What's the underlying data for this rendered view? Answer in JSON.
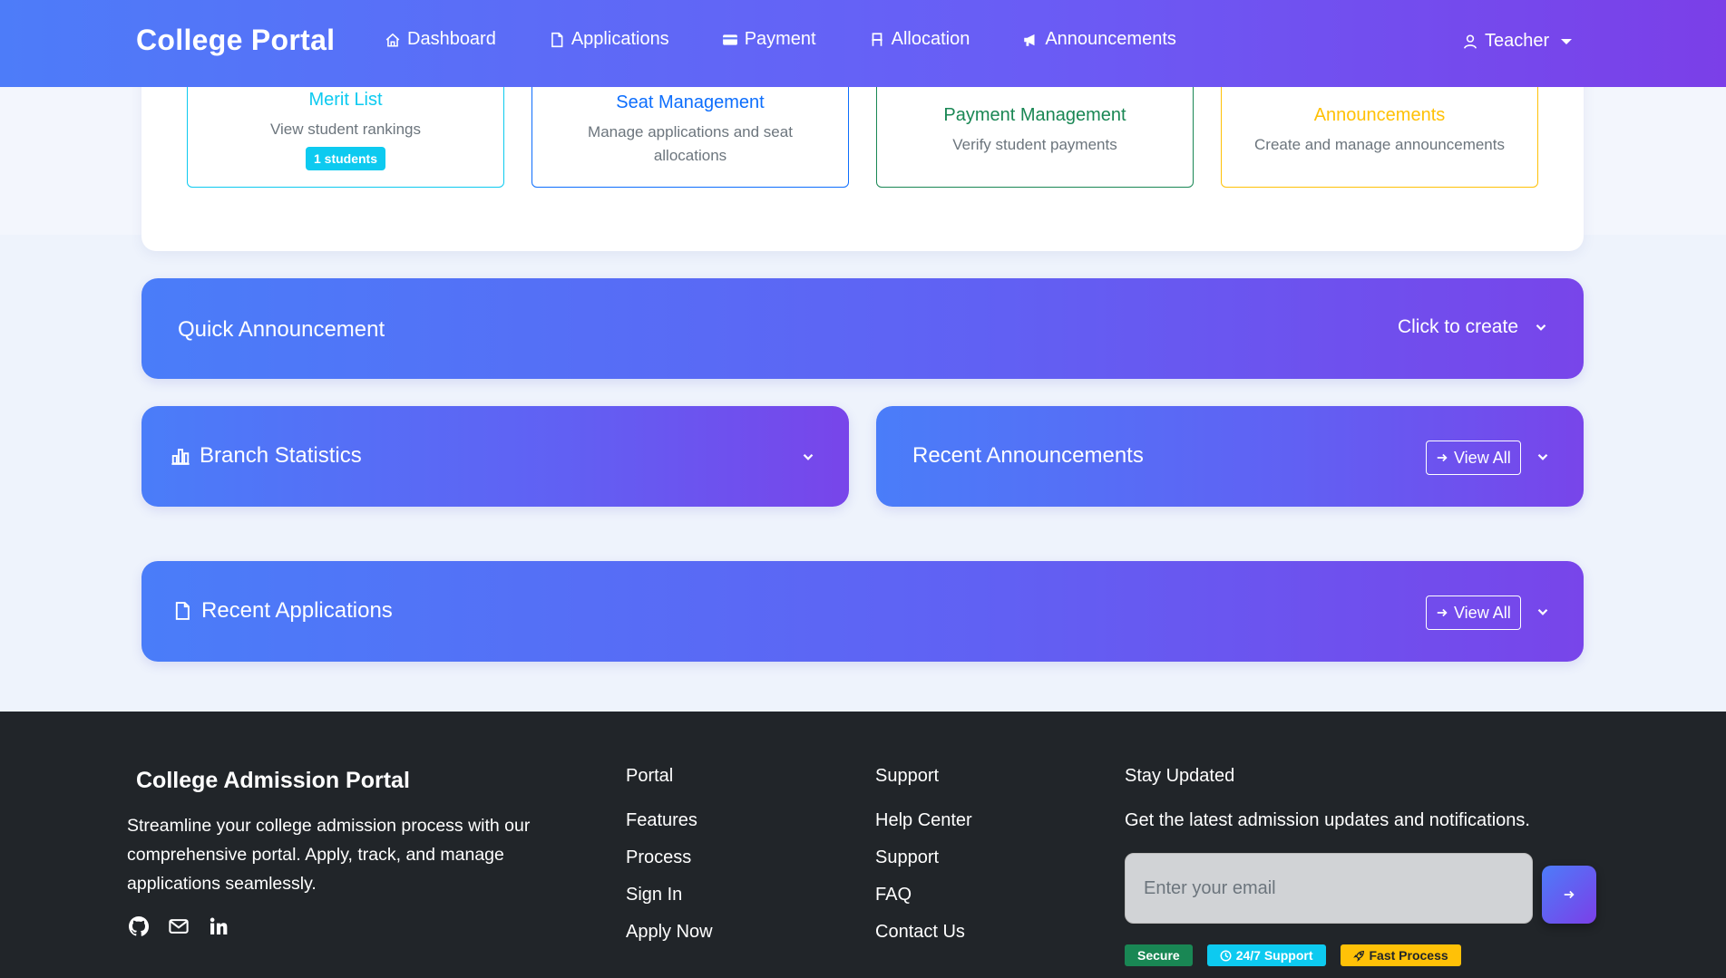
{
  "navbar": {
    "brand": "College Portal",
    "links": [
      {
        "label": "Dashboard",
        "icon": "house-icon"
      },
      {
        "label": "Applications",
        "icon": "file-icon"
      },
      {
        "label": "Payment",
        "icon": "credit-card-icon"
      },
      {
        "label": "Allocation",
        "icon": "chair-icon"
      },
      {
        "label": "Announcements",
        "icon": "megaphone-icon"
      }
    ],
    "user": {
      "label": "Teacher",
      "icon": "person-icon"
    }
  },
  "feature_cards": [
    {
      "title": "Merit List",
      "description": "View student rankings",
      "badge": "1 students",
      "color": "#0dcaf0"
    },
    {
      "title": "Seat Management",
      "description": "Manage applications and seat allocations",
      "color": "#0d6efd"
    },
    {
      "title": "Payment Management",
      "description": "Verify student payments",
      "color": "#198754"
    },
    {
      "title": "Announcements",
      "description": "Create and manage announcements",
      "color": "#ffc107"
    }
  ],
  "quick_announcement": {
    "title": "Quick Announcement",
    "action": "Click to create"
  },
  "branch_statistics": {
    "title": "Branch Statistics",
    "icon": "bar-chart-icon"
  },
  "recent_announcements": {
    "title": "Recent Announcements",
    "view_all": "View All"
  },
  "recent_applications": {
    "title": "Recent Applications",
    "view_all": "View All",
    "icon": "file-icon"
  },
  "footer": {
    "brand": "College Admission Portal",
    "description": "Streamline your college admission process with our comprehensive portal. Apply, track, and manage applications seamlessly.",
    "social": [
      "github-icon",
      "envelope-icon",
      "linkedin-icon"
    ],
    "portal": {
      "heading": "Portal",
      "links": [
        "Features",
        "Process",
        "Sign In",
        "Apply Now"
      ]
    },
    "support": {
      "heading": "Support",
      "links": [
        "Help Center",
        "Support",
        "FAQ",
        "Contact Us"
      ]
    },
    "stay_updated": {
      "heading": "Stay Updated",
      "subtext": "Get the latest admission updates and notifications.",
      "email_placeholder": "Enter your email"
    },
    "badges": [
      {
        "label": "Secure",
        "color": "#198754"
      },
      {
        "label": "24/7 Support",
        "color": "#0dcaf0",
        "icon": "clock-icon"
      },
      {
        "label": "Fast Process",
        "color": "#ffc107",
        "icon": "rocket-icon"
      }
    ]
  }
}
